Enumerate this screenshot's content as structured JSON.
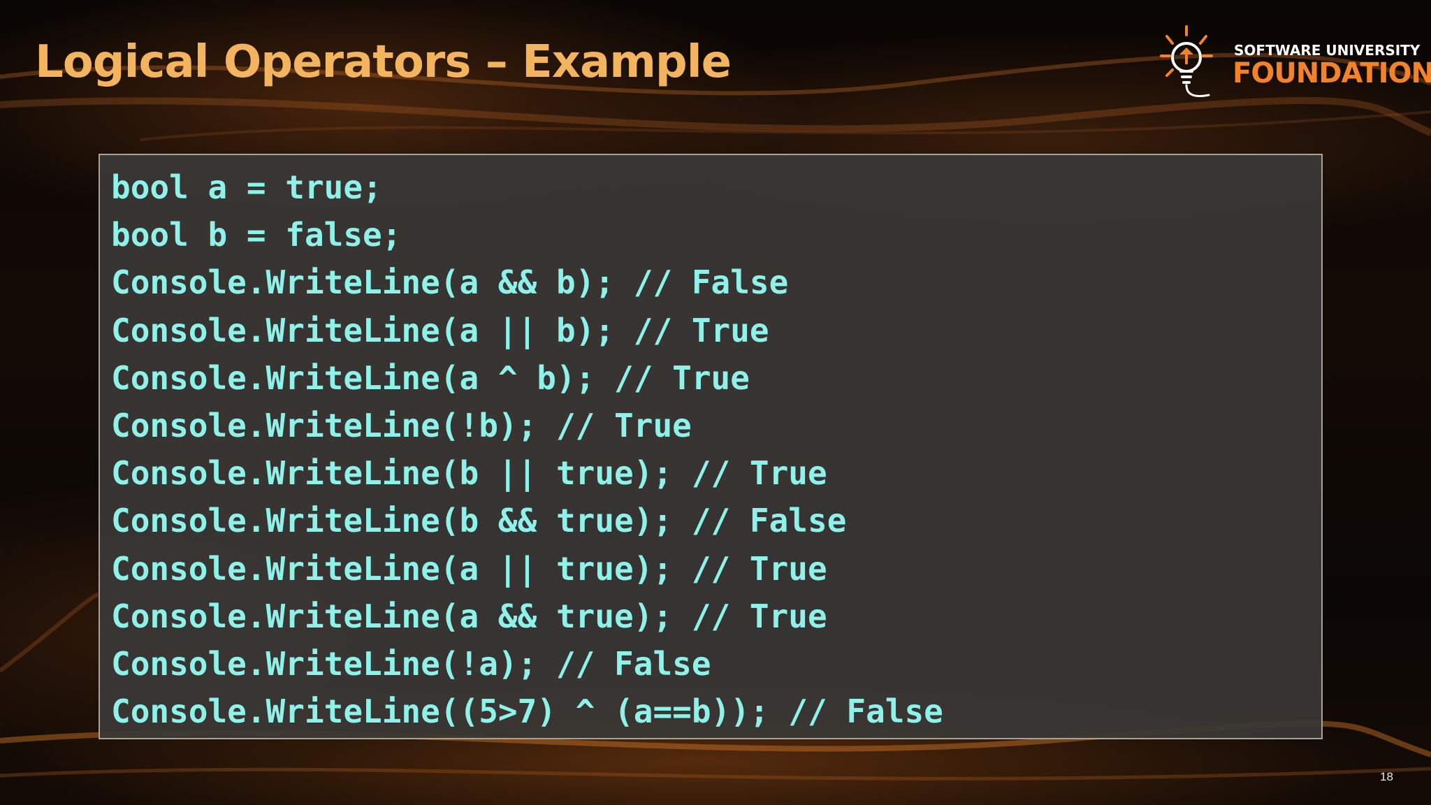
{
  "slide": {
    "title": "Logical Operators – Example",
    "page_number": "18"
  },
  "logo": {
    "line1": "SOFTWARE UNIVERSITY",
    "line2": "FOUNDATION",
    "icon": "lightbulb-icon"
  },
  "code": {
    "lines": [
      "bool a = true;",
      "bool b = false;",
      "Console.WriteLine(a && b); // False",
      "Console.WriteLine(a || b); // True",
      "Console.WriteLine(a ^ b); // True",
      "Console.WriteLine(!b); // True",
      "Console.WriteLine(b || true); // True",
      "Console.WriteLine(b && true); // False",
      "Console.WriteLine(a || true); // True",
      "Console.WriteLine(a && true); // True",
      "Console.WriteLine(!a); // False",
      "Console.WriteLine((5>7) ^ (a==b)); // False"
    ]
  },
  "colors": {
    "title": "#f2b45f",
    "code_text": "#8ff2ea",
    "code_background": "#3a3836",
    "logo_accent": "#f3832a",
    "logo_text": "#ffffff"
  }
}
